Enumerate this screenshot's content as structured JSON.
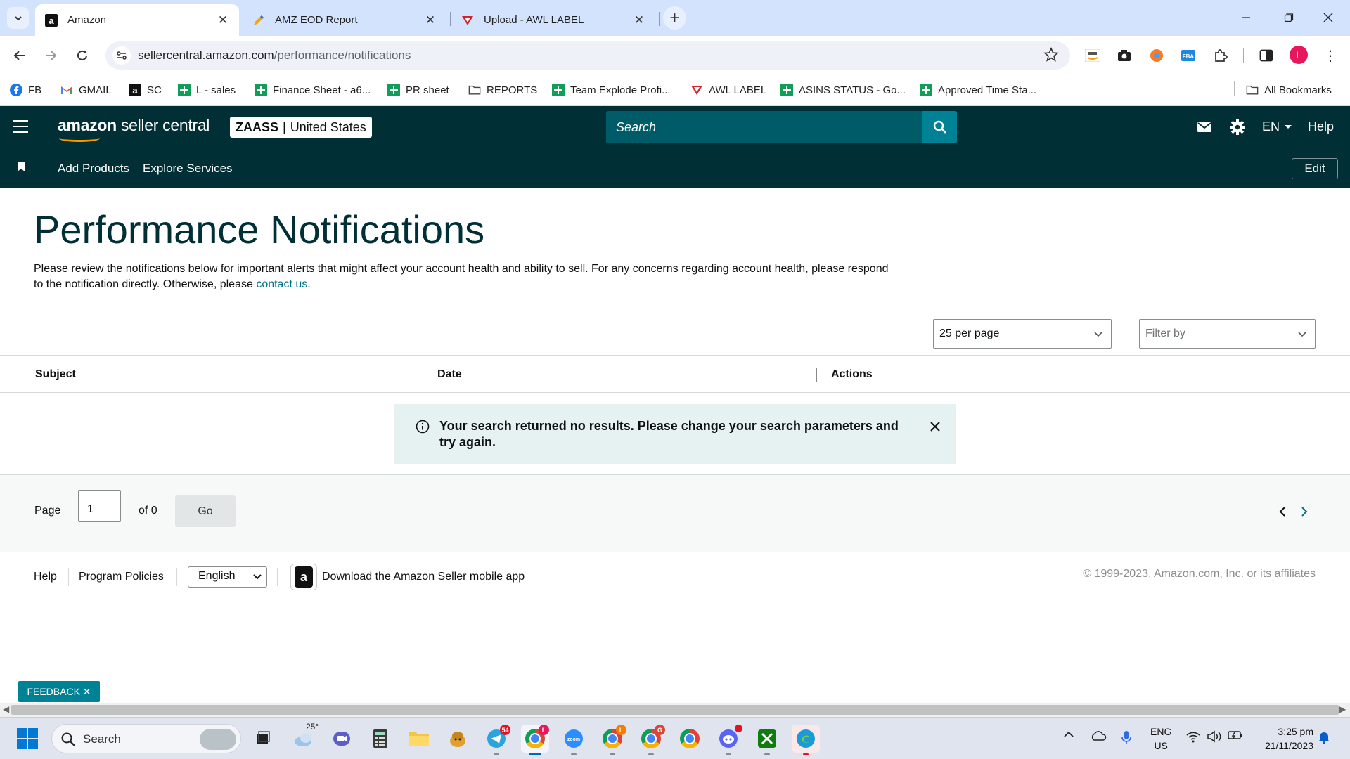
{
  "browser": {
    "tabs": [
      {
        "title": "Amazon",
        "icon": "amazon-icon",
        "active": true
      },
      {
        "title": "AMZ EOD Report",
        "icon": "pen-icon",
        "active": false
      },
      {
        "title": "Upload - AWL LABEL",
        "icon": "awl-icon",
        "active": false
      }
    ],
    "url_host": "sellercentral.amazon.com",
    "url_path": "/performance/notifications",
    "bookmarks": [
      {
        "label": "FB",
        "icon": "facebook-icon"
      },
      {
        "label": "GMAIL",
        "icon": "gmail-icon"
      },
      {
        "label": "SC",
        "icon": "amazon-icon"
      },
      {
        "label": "L - sales",
        "icon": "sheets-icon"
      },
      {
        "label": "Finance Sheet - a6...",
        "icon": "sheets-icon"
      },
      {
        "label": "PR sheet",
        "icon": "sheets-icon"
      },
      {
        "label": "REPORTS",
        "icon": "folder-icon"
      },
      {
        "label": "Team Explode Profi...",
        "icon": "sheets-icon"
      },
      {
        "label": "AWL LABEL",
        "icon": "awl-icon"
      },
      {
        "label": "ASINS STATUS - Go...",
        "icon": "sheets-icon"
      },
      {
        "label": "Approved Time Sta...",
        "icon": "sheets-icon"
      }
    ],
    "all_bookmarks": "All Bookmarks",
    "profile_initial": "L"
  },
  "header": {
    "logo_bold": "amazon",
    "logo_rest": " seller central",
    "store_name": "ZAASS",
    "store_sep": "|",
    "store_region": "United States",
    "search_placeholder": "Search",
    "language": "EN",
    "help": "Help",
    "subnav": [
      "Add Products",
      "Explore Services"
    ],
    "edit": "Edit"
  },
  "page": {
    "title": "Performance Notifications",
    "description": "Please review the notifications below for important alerts that might affect your account health and ability to sell. For any concerns regarding account health, please respond to the notification directly. Otherwise, please",
    "contact_link": "contact us",
    "contact_after": ".",
    "per_page": "25 per page",
    "filter_placeholder": "Filter by",
    "columns": [
      "Subject",
      "Date",
      "Actions"
    ],
    "alert_message": "Your search returned no results. Please change your search parameters and try again.",
    "pager": {
      "page_label": "Page",
      "page_value": "1",
      "of_label": "of 0",
      "go": "Go"
    }
  },
  "footer": {
    "help": "Help",
    "program_policies": "Program Policies",
    "language": "English",
    "download_app": "Download the Amazon Seller mobile app",
    "copyright": "© 1999-2023, Amazon.com, Inc. or its affiliates"
  },
  "feedback": "FEEDBACK ✕",
  "taskbar": {
    "search_placeholder": "Search",
    "weather_temp": "25°",
    "telegram_badge": "54",
    "lang_line1": "ENG",
    "lang_line2": "US",
    "time": "3:25 pm",
    "date": "21/11/2023"
  },
  "colors": {
    "header_bg": "#002f36",
    "search_bg": "#005b69",
    "search_btn": "#008296",
    "title_color": "#002f36",
    "link_color": "#007185",
    "alert_bg": "#e6f1f2",
    "tabbar_bg": "#d3e3fd"
  }
}
